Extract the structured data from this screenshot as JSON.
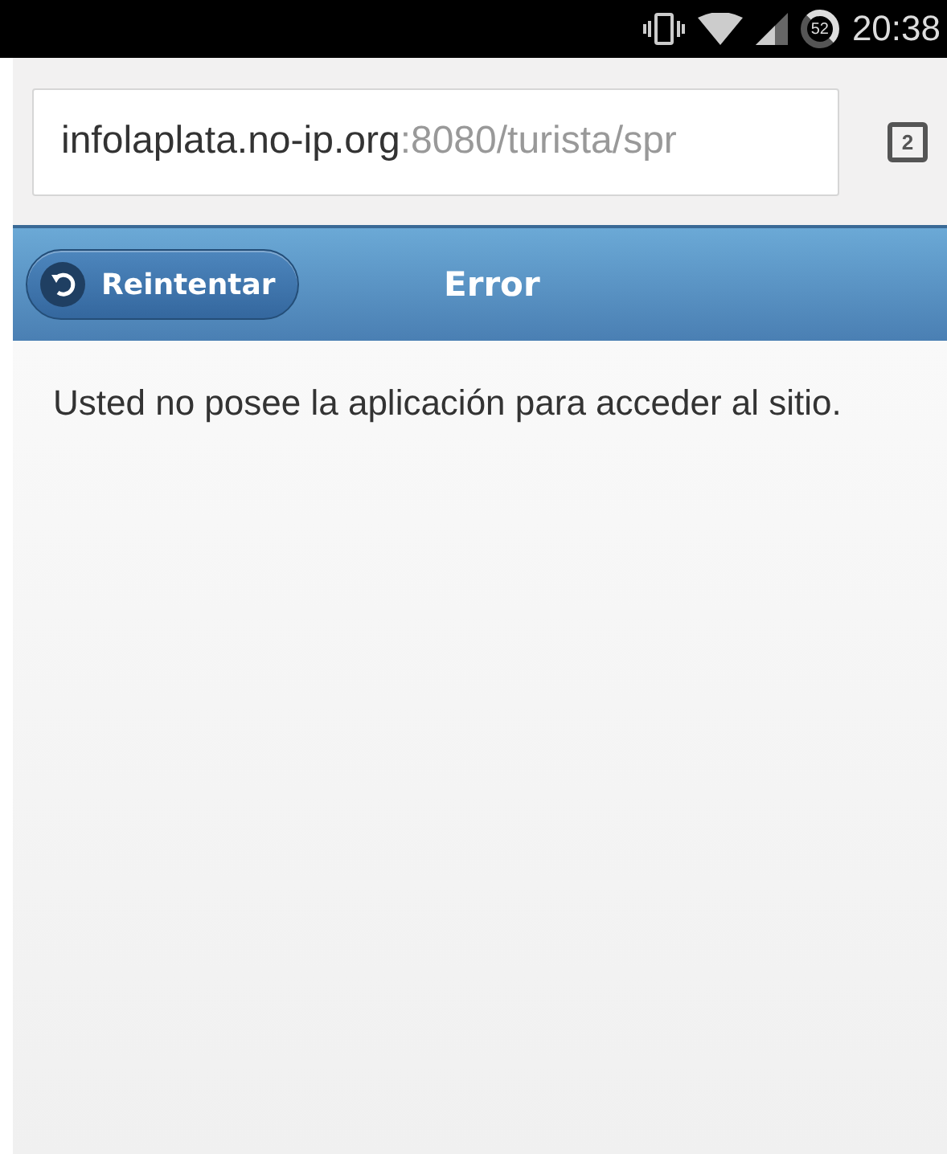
{
  "status_bar": {
    "battery": "52",
    "time": "20:38"
  },
  "address_bar": {
    "host": "infolaplata.no-ip.org",
    "rest": ":8080/turista/spr",
    "tab_count": "2"
  },
  "header": {
    "back_button": "Reintentar",
    "title": "Error"
  },
  "content": {
    "message": "Usted no posee la aplicación para acceder al sitio."
  }
}
